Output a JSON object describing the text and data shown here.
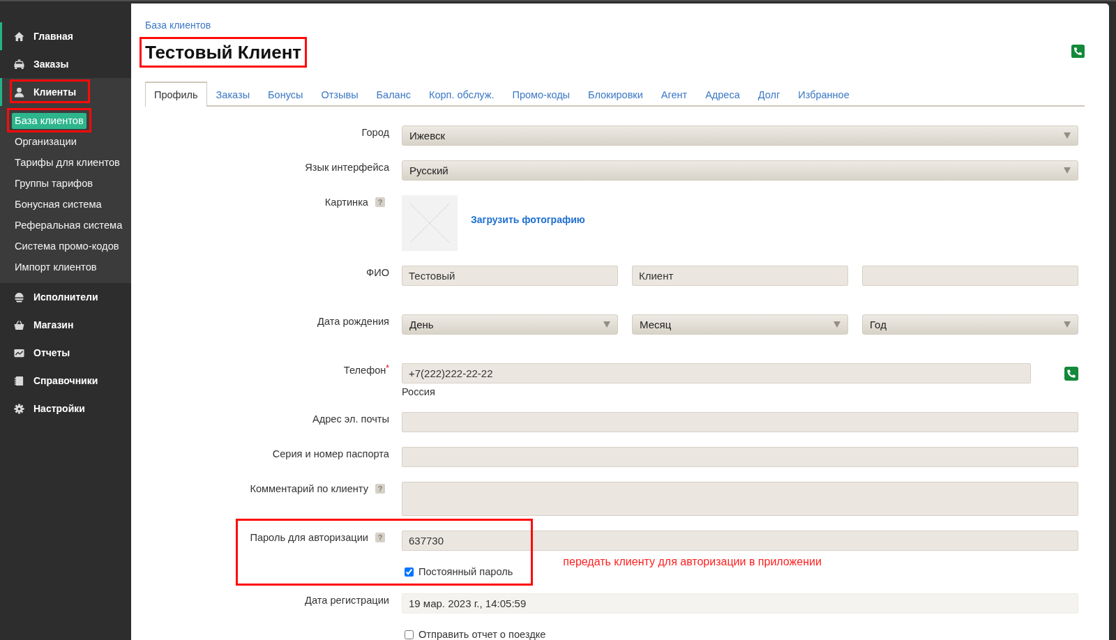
{
  "sidebar": {
    "items": [
      {
        "label": "Главная",
        "selected": true,
        "expanded": false,
        "annotated": false
      },
      {
        "label": "Заказы",
        "selected": false,
        "expanded": false,
        "annotated": false
      },
      {
        "label": "Клиенты",
        "selected": true,
        "expanded": true,
        "annotated": true,
        "children": [
          {
            "label": "База клиентов",
            "selected": true,
            "annotated": true
          },
          {
            "label": "Организации",
            "selected": false,
            "annotated": false
          },
          {
            "label": "Тарифы для клиентов",
            "selected": false,
            "annotated": false
          },
          {
            "label": "Группы тарифов",
            "selected": false,
            "annotated": false
          },
          {
            "label": "Бонусная система",
            "selected": false,
            "annotated": false
          },
          {
            "label": "Реферальная система",
            "selected": false,
            "annotated": false
          },
          {
            "label": "Система промо-кодов",
            "selected": false,
            "annotated": false
          },
          {
            "label": "Импорт клиентов",
            "selected": false,
            "annotated": false
          }
        ]
      },
      {
        "label": "Исполнители",
        "selected": false,
        "expanded": false,
        "annotated": false
      },
      {
        "label": "Магазин",
        "selected": false,
        "expanded": false,
        "annotated": false
      },
      {
        "label": "Отчеты",
        "selected": false,
        "expanded": false,
        "annotated": false
      },
      {
        "label": "Справочники",
        "selected": false,
        "expanded": false,
        "annotated": false
      },
      {
        "label": "Настройки",
        "selected": false,
        "expanded": false,
        "annotated": false
      }
    ]
  },
  "breadcrumbs": [
    "База клиентов"
  ],
  "title": {
    "text": "Тестовый Клиент",
    "annotated": true
  },
  "tabs": [
    {
      "label": "Профиль",
      "selected": true
    },
    {
      "label": "Заказы",
      "selected": false
    },
    {
      "label": "Бонусы",
      "selected": false
    },
    {
      "label": "Отзывы",
      "selected": false
    },
    {
      "label": "Баланс",
      "selected": false
    },
    {
      "label": "Корп. обслуж.",
      "selected": false
    },
    {
      "label": "Промо-коды",
      "selected": false
    },
    {
      "label": "Блокировки",
      "selected": false
    },
    {
      "label": "Агент",
      "selected": false
    },
    {
      "label": "Адреса",
      "selected": false
    },
    {
      "label": "Долг",
      "selected": false
    },
    {
      "label": "Избранное",
      "selected": false
    }
  ],
  "form": {
    "rows": [
      {
        "kind": "select",
        "label": "Город",
        "value": "Ижевск"
      },
      {
        "kind": "select",
        "label": "Язык интерфейса",
        "value": "Русский"
      },
      {
        "kind": "image",
        "label": "Картинка",
        "help": "?",
        "link": "Загрузить фотографию"
      },
      {
        "kind": "fields",
        "label": "ФИО",
        "fields": [
          {
            "kind": "input",
            "value": "Тестовый"
          },
          {
            "kind": "input",
            "value": "Клиент"
          },
          {
            "kind": "input"
          }
        ]
      },
      {
        "kind": "fields",
        "label": "Дата рождения",
        "fields": [
          {
            "kind": "select",
            "value": "День"
          },
          {
            "kind": "select",
            "value": "Месяц"
          },
          {
            "kind": "select",
            "value": "Год"
          }
        ]
      },
      {
        "kind": "phone",
        "label": "Телефон",
        "required_mark": "*",
        "value": "+7(222)222-22-22",
        "country": "Россия"
      },
      {
        "kind": "input",
        "label": "Адрес эл. почты"
      },
      {
        "kind": "input",
        "label": "Серия и номер паспорта"
      },
      {
        "kind": "textarea",
        "label": "Комментарий по клиенту",
        "help": "?"
      },
      {
        "kind": "group",
        "annotated": true,
        "note": "передать клиенту для авторизации в приложении",
        "rows": [
          {
            "kind": "input",
            "label": "Пароль для авторизации",
            "help": "?",
            "value": "637730"
          },
          {
            "kind": "checkbox",
            "text": "Постоянный пароль",
            "checked": true
          }
        ]
      },
      {
        "kind": "readonly",
        "label": "Дата регистрации",
        "value": "19 мар. 2023 г., 14:05:59"
      },
      {
        "kind": "checkbox",
        "text": "Отправить отчет о поездке",
        "checked": false
      }
    ]
  }
}
